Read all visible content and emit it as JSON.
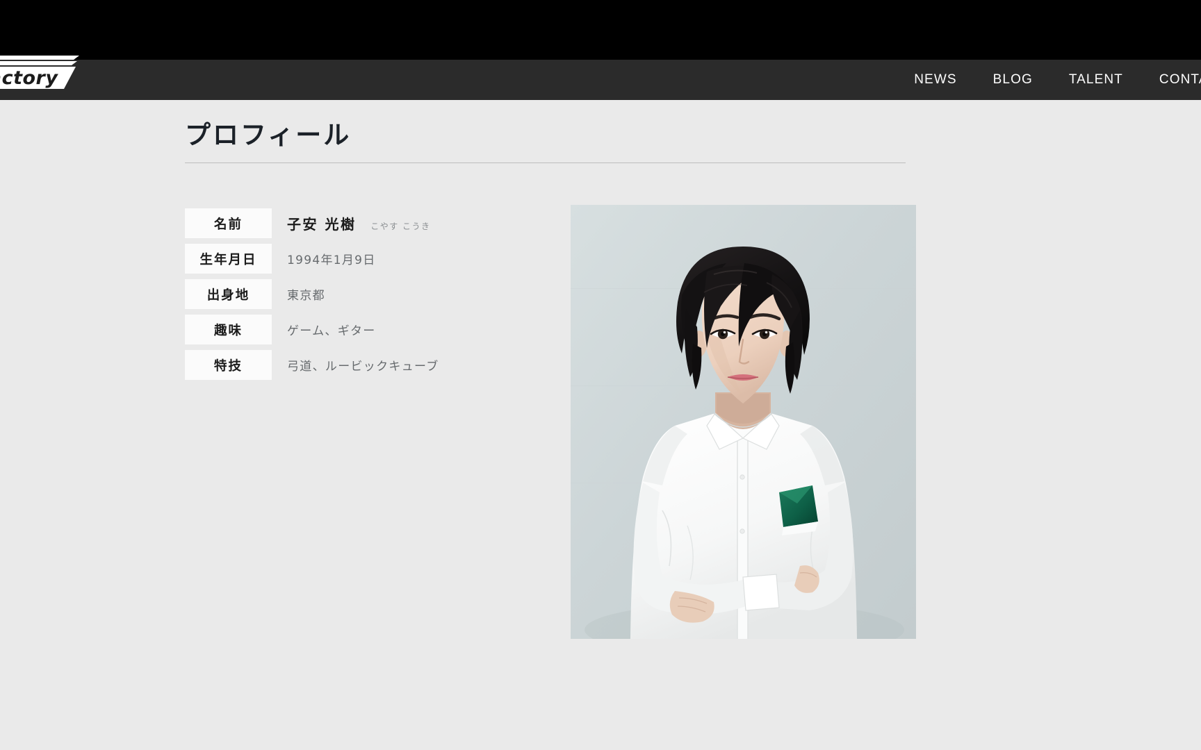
{
  "header": {
    "logo_text": "Factory",
    "logo_icon": "factory-wordmark-logo",
    "nav": [
      {
        "label": "NEWS",
        "name": "nav-news"
      },
      {
        "label": "BLOG",
        "name": "nav-blog"
      },
      {
        "label": "TALENT",
        "name": "nav-talent"
      },
      {
        "label": "CONTACT",
        "name": "nav-contact"
      }
    ]
  },
  "main": {
    "page_title": "プロフィール",
    "profile_rows": [
      {
        "label": "名前",
        "value": "子安 光樹",
        "kana": "こやす こうき"
      },
      {
        "label": "生年月日",
        "value": "1994年1月9日",
        "kana": ""
      },
      {
        "label": "出身地",
        "value": "東京都",
        "kana": ""
      },
      {
        "label": "趣味",
        "value": "ゲーム、ギター",
        "kana": ""
      },
      {
        "label": "特技",
        "value": "弓道、ルービックキューブ",
        "kana": ""
      }
    ],
    "photo": {
      "alt": "子安 光樹 プロフィール写真",
      "name": "talent-portrait-photo"
    }
  },
  "colors": {
    "header_bar": "#2b2b2b",
    "top_strip": "#000000",
    "page_bg": "#eaeaea",
    "label_bg": "#fbfbfb",
    "title_text": "#1b2128",
    "value_text": "#666a6d",
    "nav_text": "#ffffff",
    "pocket_square": "#11694f"
  }
}
